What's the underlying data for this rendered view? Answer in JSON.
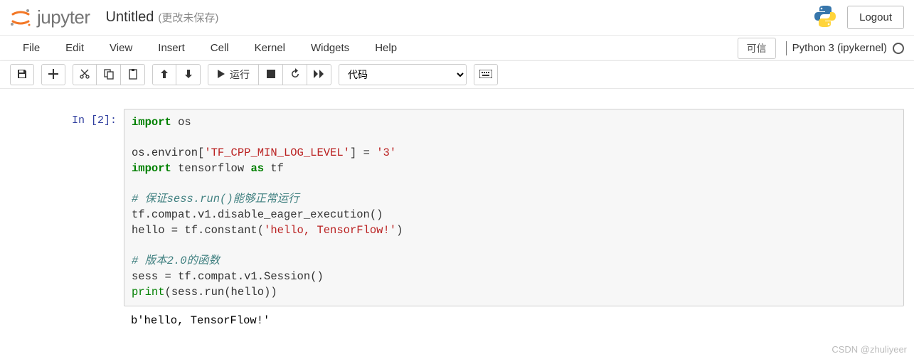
{
  "header": {
    "logo_text": "jupyter",
    "title": "Untitled",
    "unsaved_text": "(更改未保存)",
    "logout_label": "Logout"
  },
  "menu": {
    "file": "File",
    "edit": "Edit",
    "view": "View",
    "insert": "Insert",
    "cell": "Cell",
    "kernel": "Kernel",
    "widgets": "Widgets",
    "help": "Help",
    "trusted": "可信",
    "kernel_name": "Python 3 (ipykernel)"
  },
  "toolbar": {
    "run_label": "运行",
    "cell_type": "代码"
  },
  "cell": {
    "prompt_in": "In ",
    "prompt_num": "[2]:",
    "code": {
      "l1_kw1": "import",
      "l1_t1": " os",
      "l3_t1": "os.environ[",
      "l3_s1": "'TF_CPP_MIN_LOG_LEVEL'",
      "l3_t2": "] = ",
      "l3_s2": "'3'",
      "l4_kw1": "import",
      "l4_t1": " tensorflow ",
      "l4_kw2": "as",
      "l4_t2": " tf",
      "l6_c1": "# 保证sess.run()能够正常运行",
      "l7_t1": "tf.compat.v1.disable_eager_execution()",
      "l8_t1": "hello = tf.constant(",
      "l8_s1": "'hello, TensorFlow!'",
      "l8_t2": ")",
      "l10_c1": "# 版本2.0的函数",
      "l11_t1": "sess = tf.compat.v1.Session()",
      "l12_b1": "print",
      "l12_t1": "(sess.run(hello))"
    },
    "output": "b'hello, TensorFlow!'"
  },
  "watermark": "CSDN @zhuliyeer"
}
